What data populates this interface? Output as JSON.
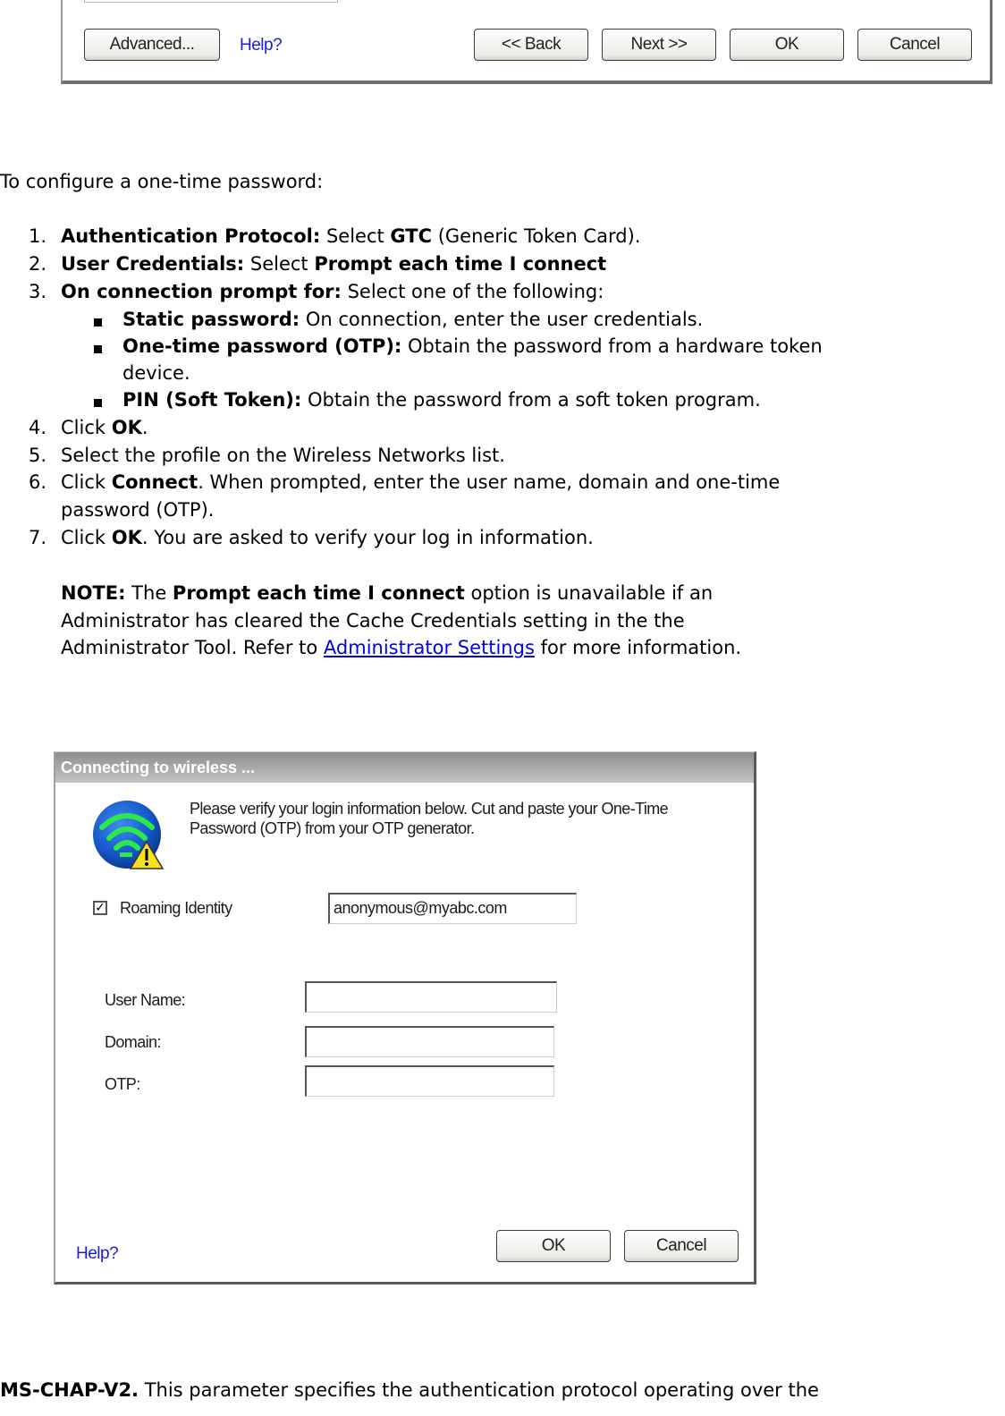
{
  "top_dialog": {
    "buttons": {
      "advanced": "Advanced...",
      "back": "<< Back",
      "next": "Next >>",
      "ok": "OK",
      "cancel": "Cancel"
    },
    "help_link": "Help?"
  },
  "intro": "To configure a one-time password:",
  "steps": [
    {
      "number": "1.",
      "bold": "Authentication Protocol:",
      "text1": " Select ",
      "bold2": "GTC",
      "text2": " (Generic Token Card)."
    },
    {
      "number": "2.",
      "bold": "User Credentials:",
      "text1": " Select ",
      "bold2": "Prompt each time I connect"
    },
    {
      "number": "3.",
      "bold": "On connection prompt for:",
      "text1": " Select one of the following:"
    },
    {
      "number": "4.",
      "text1": "Click ",
      "bold": "OK",
      "text2": "."
    },
    {
      "number": "5.",
      "text1": "Select the profile on the Wireless Networks list."
    },
    {
      "number": "6.",
      "text1": "Click ",
      "bold": "Connect",
      "text2": ". When prompted, enter the user name, domain and one-time",
      "text3": "password (OTP)."
    },
    {
      "number": "7.",
      "text1": "Click ",
      "bold": "OK",
      "text2": ". You are asked to verify your log in information."
    }
  ],
  "sub_bullets": [
    {
      "bold": "Static password:",
      "text": " On connection, enter the user credentials."
    },
    {
      "bold": "One-time password (OTP):",
      "text": " Obtain the password from a hardware token",
      "text_cont": "device."
    },
    {
      "bold": "PIN (Soft Token):",
      "text": " Obtain the password from a soft token program."
    }
  ],
  "note": {
    "label": "NOTE:",
    "text1": " The ",
    "bold": "Prompt each time I connect",
    "text2": " option is unavailable if an",
    "line2": "Administrator has cleared the Cache Credentials setting in the the",
    "line3_pre": "Administrator Tool. Refer to ",
    "link": "Administrator Settings",
    "line3_post": " for more information."
  },
  "dialog": {
    "title": "Connecting to wireless ...",
    "message_line1": "Please verify your login information below. Cut and paste your One-Time",
    "message_line2": "Password (OTP) from your OTP generator.",
    "roaming_identity": {
      "label": "Roaming Identity",
      "checked": true,
      "value": "anonymous@myabc.com"
    },
    "fields": [
      {
        "label": "User Name:",
        "value": ""
      },
      {
        "label": "Domain:",
        "value": ""
      },
      {
        "label": "OTP:",
        "value": ""
      }
    ],
    "help_link": "Help?",
    "ok": "OK",
    "cancel": "Cancel",
    "icon": "wireless-warning-icon"
  },
  "footer": {
    "bold": "MS-CHAP-V2.",
    "text": " This parameter specifies the authentication protocol operating over the"
  }
}
